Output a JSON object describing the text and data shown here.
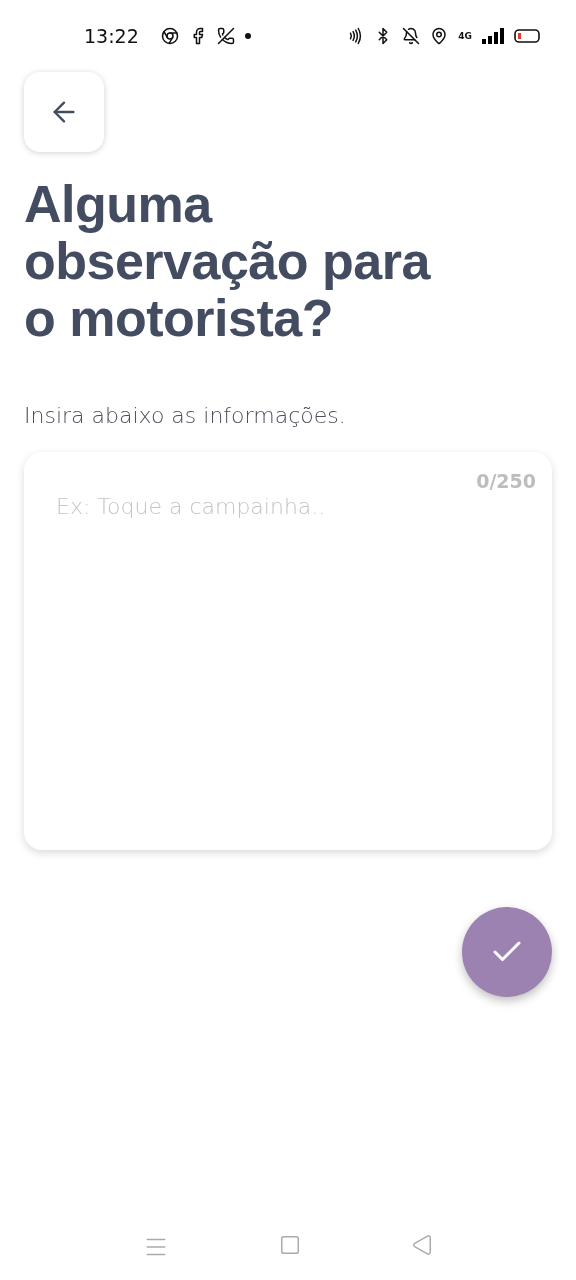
{
  "status_bar": {
    "time": "13:22",
    "network": "4G"
  },
  "title": "Alguma observação para o motorista?",
  "subtitle": "Insira abaixo as informações.",
  "note_field": {
    "placeholder": "Ex: Toque a campainha..",
    "counter": "0/250"
  }
}
